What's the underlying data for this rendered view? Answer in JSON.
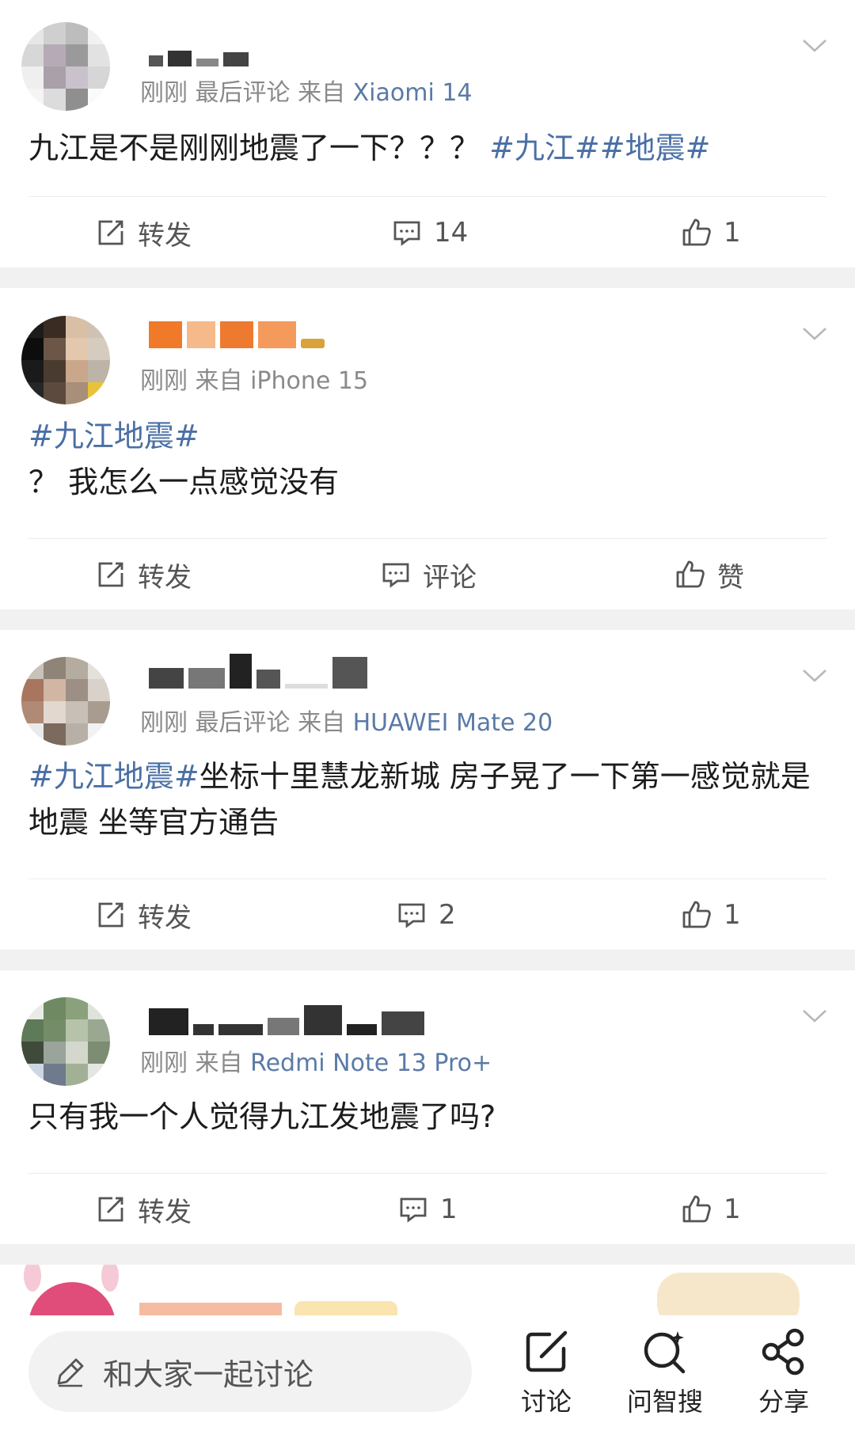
{
  "posts": [
    {
      "meta_prefix": "刚刚 最后评论  来自 ",
      "device": "Xiaomi 14",
      "text_plain": "九江是不是刚刚地震了一下？？？ ",
      "text_tag": "#九江##地震#",
      "repost_label": "转发",
      "comment_label": "14",
      "like_label": "1"
    },
    {
      "meta_prefix": "刚刚  来自 ",
      "device": "iPhone 15",
      "tag_line": "#九江地震#",
      "text_plain": "？ 我怎么一点感觉没有",
      "repost_label": "转发",
      "comment_label": "评论",
      "like_label": "赞"
    },
    {
      "meta_prefix": "刚刚 最后评论  来自 ",
      "device": "HUAWEI Mate 20",
      "text_tag": "#九江地震#",
      "text_plain": "坐标十里慧龙新城   房子晃了一下第一感觉就是地震  坐等官方通告",
      "repost_label": "转发",
      "comment_label": "2",
      "like_label": "1"
    },
    {
      "meta_prefix": "刚刚  来自 ",
      "device": "Redmi Note 13 Pro+",
      "text_plain": "只有我一个人觉得九江发地震了吗?",
      "repost_label": "转发",
      "comment_label": "1",
      "like_label": "1"
    }
  ],
  "bottom_bar": {
    "compose_placeholder": "和大家一起讨论",
    "discuss_label": "讨论",
    "ask_label": "问智搜",
    "share_label": "分享"
  },
  "icons": {
    "repost": "repost-icon",
    "comment": "comment-icon",
    "like": "thumbs-up-icon",
    "chevron": "chevron-down-icon",
    "pencil": "pencil-icon",
    "discuss": "edit-square-icon",
    "ask": "search-sparkle-icon",
    "share": "share-icon"
  },
  "colors": {
    "tag": "#4a6fa5",
    "device": "#5a7aa6",
    "meta": "#8a8a8a",
    "separator": "#f1f1f1"
  }
}
